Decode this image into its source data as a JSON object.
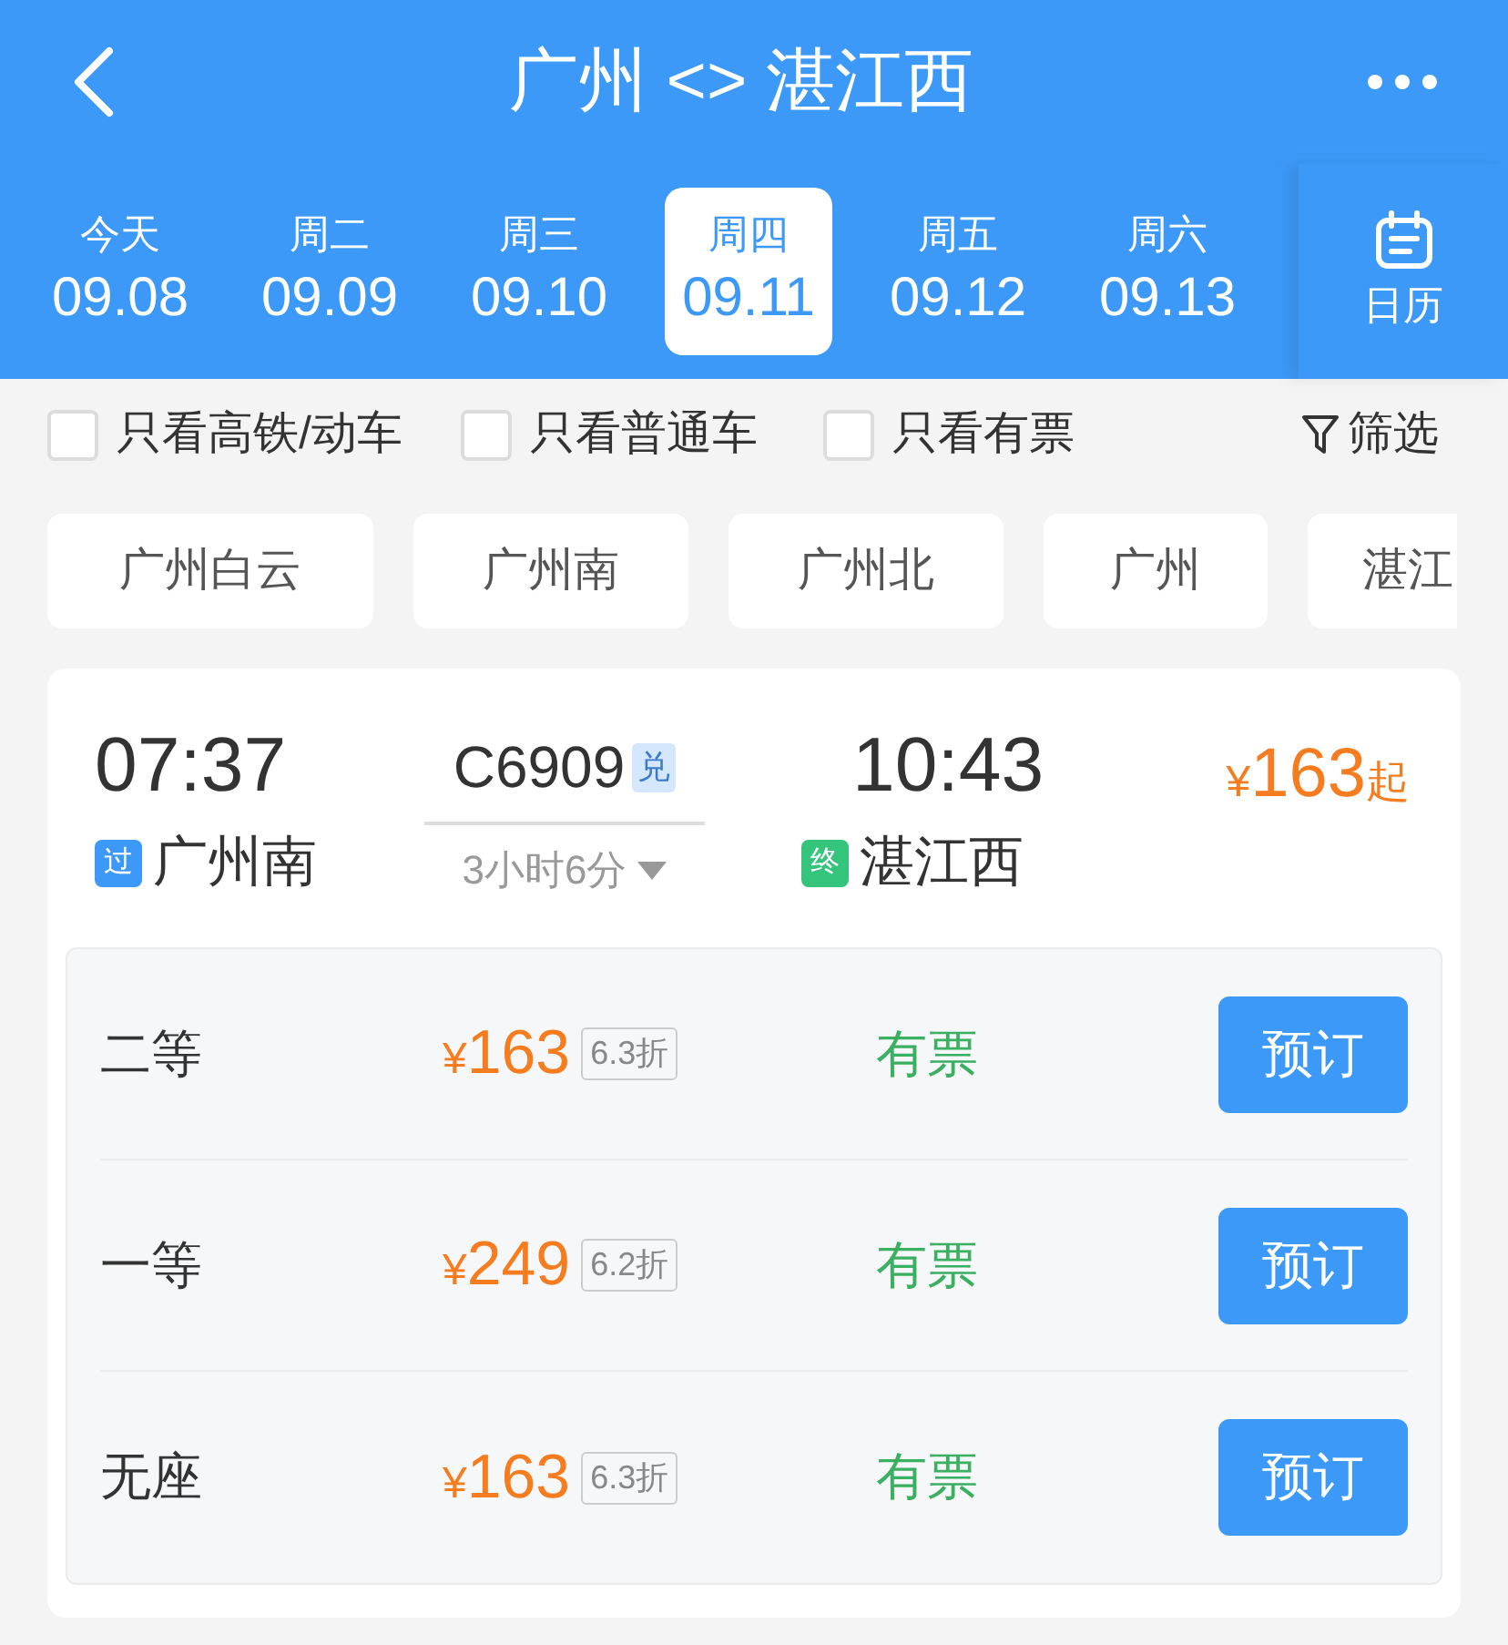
{
  "header": {
    "title": "广州 <> 湛江西"
  },
  "dates": [
    {
      "weekday": "今天",
      "date": "09.08",
      "selected": false
    },
    {
      "weekday": "周二",
      "date": "09.09",
      "selected": false
    },
    {
      "weekday": "周三",
      "date": "09.10",
      "selected": false
    },
    {
      "weekday": "周四",
      "date": "09.11",
      "selected": true
    },
    {
      "weekday": "周五",
      "date": "09.12",
      "selected": false
    },
    {
      "weekday": "周六",
      "date": "09.13",
      "selected": false
    }
  ],
  "calendar_label": "日历",
  "filters": [
    {
      "label": "只看高铁/动车",
      "checked": false
    },
    {
      "label": "只看普通车",
      "checked": false
    },
    {
      "label": "只看有票",
      "checked": false
    }
  ],
  "filter_button": "筛选",
  "stations": [
    "广州白云",
    "广州南",
    "广州北",
    "广州",
    "湛江"
  ],
  "train": {
    "depart_time": "07:37",
    "depart_tag": "过",
    "depart_station": "广州南",
    "number": "C6909",
    "number_badge": "兑",
    "duration": "3小时6分",
    "arrive_time": "10:43",
    "arrive_tag": "终",
    "arrive_station": "湛江西",
    "price_symbol": "¥",
    "price": "163",
    "price_suffix": "起"
  },
  "seats": [
    {
      "class": "二等",
      "price_symbol": "¥",
      "price": "163",
      "discount": "6.3折",
      "availability": "有票",
      "button": "预订"
    },
    {
      "class": "一等",
      "price_symbol": "¥",
      "price": "249",
      "discount": "6.2折",
      "availability": "有票",
      "button": "预订"
    },
    {
      "class": "无座",
      "price_symbol": "¥",
      "price": "163",
      "discount": "6.3折",
      "availability": "有票",
      "button": "预订"
    }
  ]
}
